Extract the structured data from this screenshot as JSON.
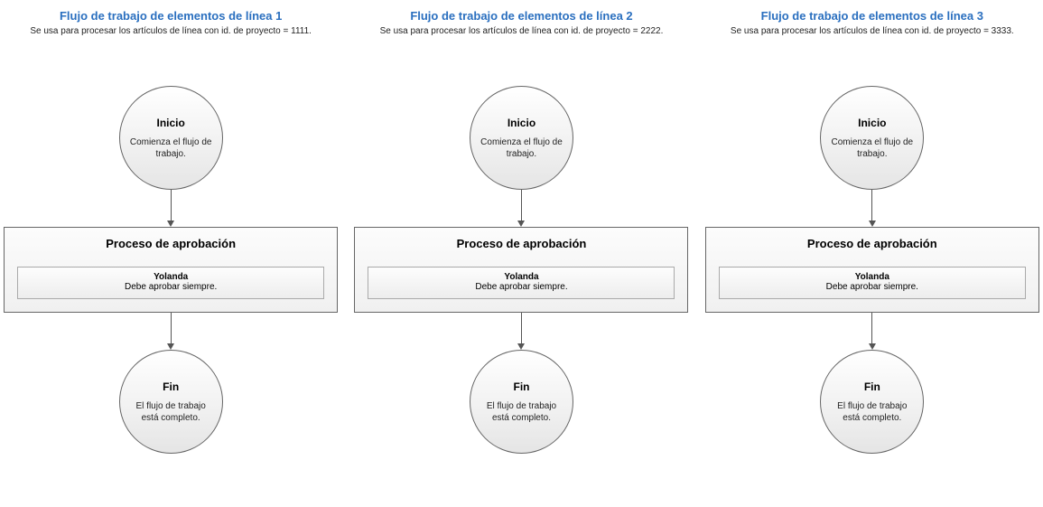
{
  "workflows": [
    {
      "title": "Flujo de trabajo de elementos de línea 1",
      "subtitle": "Se usa para procesar los artículos de línea con id. de proyecto = 1111.",
      "start_title": "Inicio",
      "start_text": "Comienza el flujo de trabajo.",
      "proc_title": "Proceso de aprobación",
      "approver_name": "Yolanda",
      "approver_rule": "Debe aprobar siempre.",
      "end_title": "Fin",
      "end_text": "El flujo de trabajo está completo."
    },
    {
      "title": "Flujo de trabajo de elementos de línea 2",
      "subtitle": "Se usa para procesar los artículos de línea con id. de proyecto = 2222.",
      "start_title": "Inicio",
      "start_text": "Comienza el flujo de trabajo.",
      "proc_title": "Proceso de aprobación",
      "approver_name": "Yolanda",
      "approver_rule": "Debe aprobar siempre.",
      "end_title": "Fin",
      "end_text": "El flujo de trabajo está completo."
    },
    {
      "title": "Flujo de trabajo de elementos de línea 3",
      "subtitle": "Se usa para procesar los artículos de línea con id. de proyecto = 3333.",
      "start_title": "Inicio",
      "start_text": "Comienza el flujo de trabajo.",
      "proc_title": "Proceso de aprobación",
      "approver_name": "Yolanda",
      "approver_rule": "Debe aprobar siempre.",
      "end_title": "Fin",
      "end_text": "El flujo de trabajo está completo."
    }
  ]
}
